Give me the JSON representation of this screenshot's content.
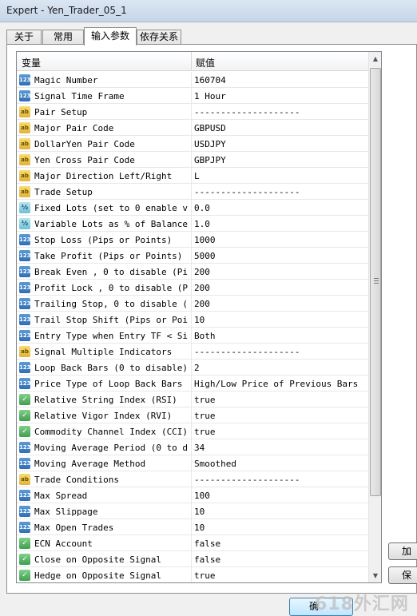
{
  "window": {
    "title": "Expert - Yen_Trader_05_1"
  },
  "tabs": [
    {
      "label": "关于"
    },
    {
      "label": "常用"
    },
    {
      "label": "输入参数",
      "active": true
    },
    {
      "label": "依存关系"
    }
  ],
  "grid": {
    "col_variable": "变量",
    "col_value": "赋值",
    "rows": [
      {
        "icon": "int-icon",
        "name": "Magic Number",
        "value": "160704"
      },
      {
        "icon": "int-icon",
        "name": "Signal Time Frame",
        "value": "1 Hour"
      },
      {
        "icon": "string-icon",
        "name": "Pair Setup",
        "value": "--------------------"
      },
      {
        "icon": "string-icon",
        "name": "Major Pair Code",
        "value": "GBPUSD"
      },
      {
        "icon": "string-icon",
        "name": "DollarYen Pair Code",
        "value": "USDJPY"
      },
      {
        "icon": "string-icon",
        "name": "Yen Cross Pair Code",
        "value": "GBPJPY"
      },
      {
        "icon": "string-icon",
        "name": "Major Direction Left/Right",
        "value": "L"
      },
      {
        "icon": "string-icon",
        "name": "Trade Setup",
        "value": "--------------------"
      },
      {
        "icon": "double-icon",
        "name": "Fixed Lots (set to 0 enable v...",
        "value": "0.0"
      },
      {
        "icon": "double-icon",
        "name": "Variable Lots as % of Balance",
        "value": "1.0"
      },
      {
        "icon": "int-icon",
        "name": "Stop Loss (Pips or Points)",
        "value": "1000"
      },
      {
        "icon": "int-icon",
        "name": "Take Profit (Pips or Points)",
        "value": "5000"
      },
      {
        "icon": "int-icon",
        "name": "Break Even , 0 to disable (Pi...",
        "value": "200"
      },
      {
        "icon": "int-icon",
        "name": "Profit Lock , 0 to disable (P...",
        "value": "200"
      },
      {
        "icon": "int-icon",
        "name": "Trailing Stop, 0 to disable (...",
        "value": "200"
      },
      {
        "icon": "int-icon",
        "name": "Trail Stop Shift (Pips or Poi...",
        "value": "10"
      },
      {
        "icon": "int-icon",
        "name": "Entry Type when Entry TF < Si...",
        "value": "Both"
      },
      {
        "icon": "string-icon",
        "name": "Signal Multiple Indicators",
        "value": "--------------------"
      },
      {
        "icon": "int-icon",
        "name": "Loop Back Bars (0 to disable)",
        "value": "2"
      },
      {
        "icon": "int-icon",
        "name": "Price Type of Loop Back Bars",
        "value": "High/Low Price of Previous Bars"
      },
      {
        "icon": "bool-icon",
        "name": "Relative String Index (RSI)",
        "value": "true"
      },
      {
        "icon": "bool-icon",
        "name": "Relative Vigor Index (RVI)",
        "value": "true"
      },
      {
        "icon": "bool-icon",
        "name": "Commodity Channel Index (CCI)",
        "value": "true"
      },
      {
        "icon": "int-icon",
        "name": "Moving Average Period (0 to d...",
        "value": "34"
      },
      {
        "icon": "int-icon",
        "name": "Moving Average Method",
        "value": "Smoothed"
      },
      {
        "icon": "string-icon",
        "name": "Trade Conditions",
        "value": "--------------------"
      },
      {
        "icon": "int-icon",
        "name": "Max Spread",
        "value": "100"
      },
      {
        "icon": "int-icon",
        "name": "Max Slippage",
        "value": "10"
      },
      {
        "icon": "int-icon",
        "name": "Max Open Trades",
        "value": "10"
      },
      {
        "icon": "bool-icon",
        "name": "ECN Account",
        "value": "false"
      },
      {
        "icon": "bool-icon",
        "name": "Close on Opposite Signal",
        "value": "false"
      },
      {
        "icon": "bool-icon",
        "name": "Hedge on Opposite Signal",
        "value": "true"
      }
    ]
  },
  "side_buttons": [
    {
      "label": "加"
    },
    {
      "label": "保"
    }
  ],
  "ok_button": {
    "label": "确"
  },
  "watermark": "618外汇网",
  "icons": {
    "int-icon": "123",
    "string-icon": "ab",
    "double-icon": "½",
    "bool-icon": "✓"
  }
}
